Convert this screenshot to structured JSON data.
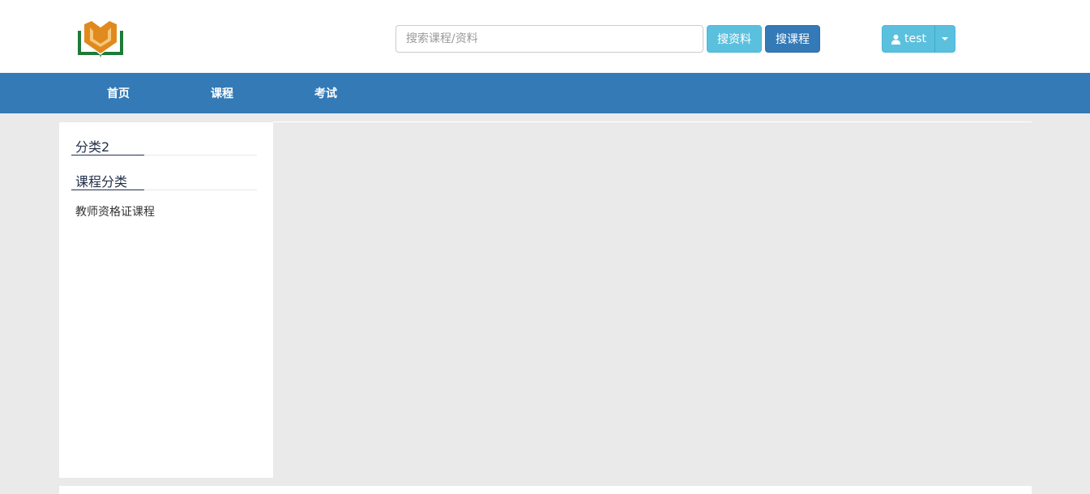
{
  "search": {
    "placeholder": "搜索课程/资料",
    "value": "",
    "btn_material": "搜资料",
    "btn_course": "搜课程"
  },
  "user": {
    "name": "test",
    "icon": "user-icon"
  },
  "nav": {
    "items": [
      {
        "label": "首页"
      },
      {
        "label": "课程"
      },
      {
        "label": "考试"
      }
    ]
  },
  "sidebar": {
    "section1": "分类2",
    "section2": "课程分类",
    "items": [
      {
        "label": "教师资格证课程"
      }
    ]
  },
  "colors": {
    "primary": "#337ab7",
    "info": "#5bc0de",
    "logo_green": "#1f7a3a",
    "logo_orange": "#e08a1e"
  }
}
